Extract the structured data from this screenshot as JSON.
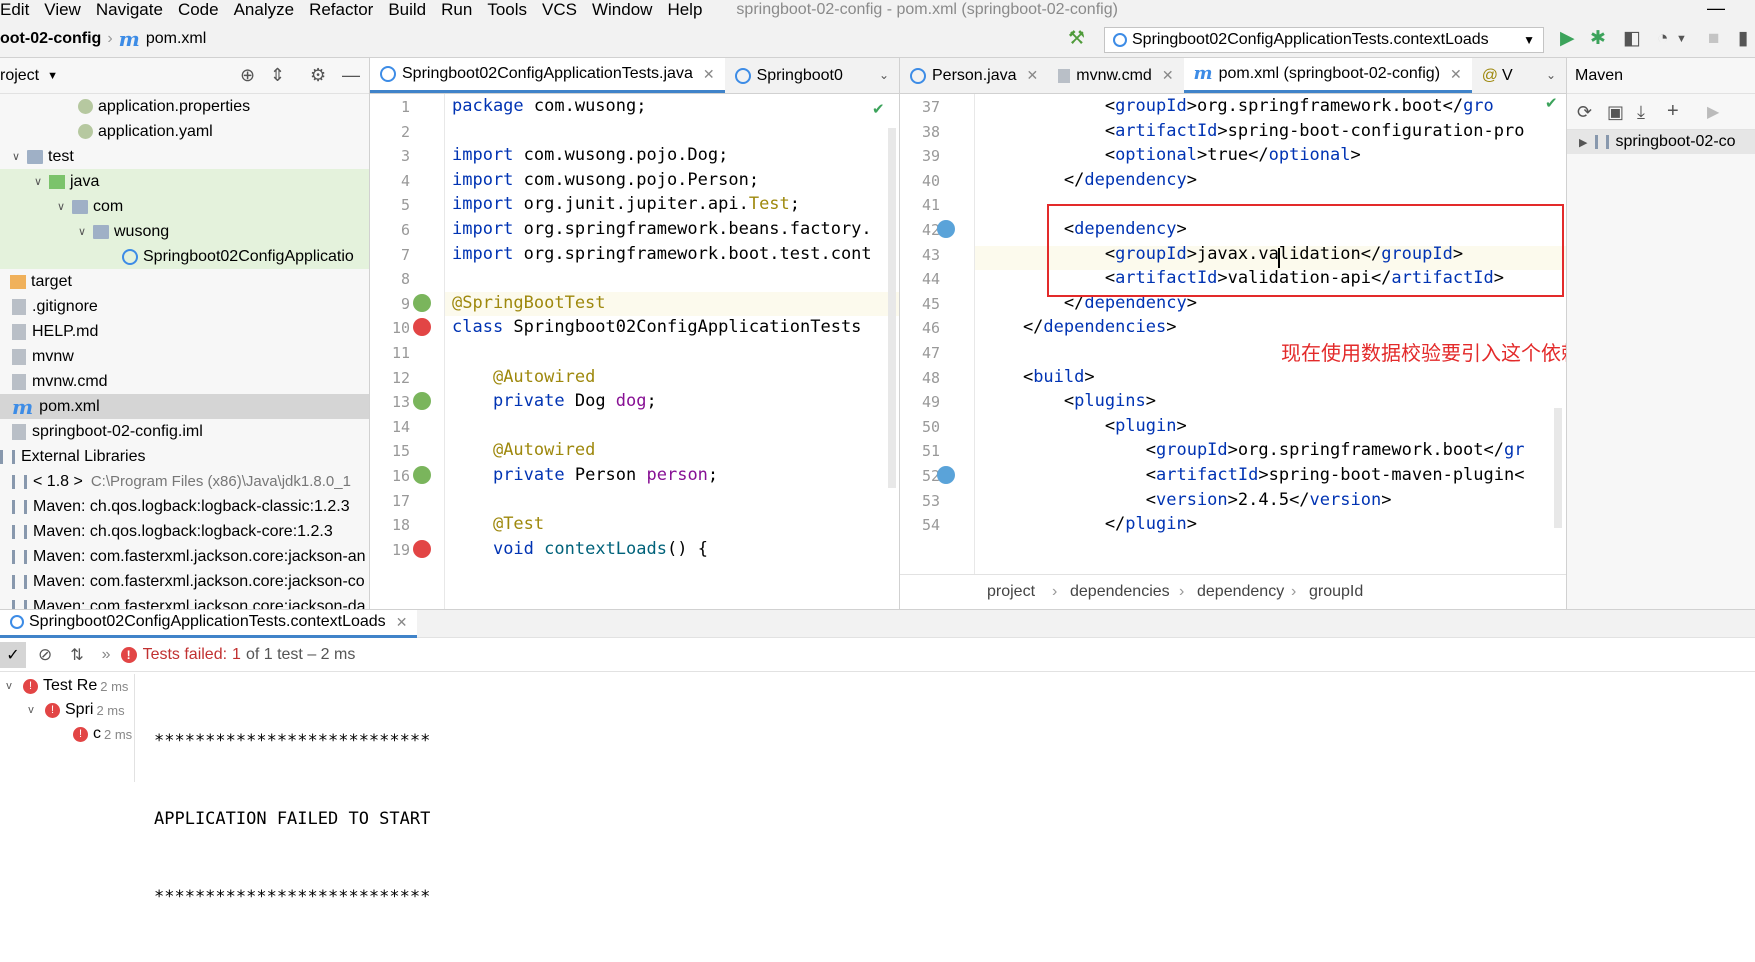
{
  "menu": [
    "Edit",
    "View",
    "Navigate",
    "Code",
    "Analyze",
    "Refactor",
    "Build",
    "Run",
    "Tools",
    "VCS",
    "Window",
    "Help"
  ],
  "window_title": "springboot-02-config - pom.xml (springboot-02-config)",
  "nav": {
    "project": "oot-02-config",
    "file": "pom.xml"
  },
  "run_config": "Springboot02ConfigApplicationTests.contextLoads",
  "project_panel": {
    "title": "roject",
    "tree": [
      {
        "label": "application.properties",
        "indent": 78,
        "icon": "properties-icon",
        "arrow": ""
      },
      {
        "label": "application.yaml",
        "indent": 78,
        "icon": "yaml-icon",
        "arrow": ""
      },
      {
        "label": "test",
        "indent": 10,
        "icon": "folder",
        "arrow": "v"
      },
      {
        "label": "java",
        "indent": 32,
        "icon": "gfolder",
        "arrow": "v"
      },
      {
        "label": "com",
        "indent": 55,
        "icon": "folder",
        "arrow": "v"
      },
      {
        "label": "wusong",
        "indent": 76,
        "icon": "folder",
        "arrow": "v"
      },
      {
        "label": "Springboot02ConfigApplicatio",
        "indent": 122,
        "icon": "class",
        "arrow": ""
      },
      {
        "label": "target",
        "indent": 10,
        "icon": "ofolder",
        "arrow": ""
      },
      {
        "label": ".gitignore",
        "indent": 12,
        "icon": "file",
        "arrow": ""
      },
      {
        "label": "HELP.md",
        "indent": 12,
        "icon": "md",
        "arrow": ""
      },
      {
        "label": "mvnw",
        "indent": 12,
        "icon": "file",
        "arrow": ""
      },
      {
        "label": "mvnw.cmd",
        "indent": 12,
        "icon": "file",
        "arrow": ""
      },
      {
        "label": "pom.xml",
        "indent": 12,
        "icon": "m",
        "arrow": ""
      },
      {
        "label": "springboot-02-config.iml",
        "indent": 12,
        "icon": "file",
        "arrow": ""
      },
      {
        "label": "External Libraries",
        "indent": 0,
        "icon": "lib",
        "arrow": ""
      },
      {
        "label": "< 1.8 >",
        "indent": 12,
        "icon": "lib",
        "arrow": "",
        "extra": "C:\\Program Files (x86)\\Java\\jdk1.8.0_1"
      },
      {
        "label": "Maven: ch.qos.logback:logback-classic:1.2.3",
        "indent": 12,
        "icon": "lib",
        "arrow": ""
      },
      {
        "label": "Maven: ch.qos.logback:logback-core:1.2.3",
        "indent": 12,
        "icon": "lib",
        "arrow": ""
      },
      {
        "label": "Maven: com.fasterxml.jackson.core:jackson-an",
        "indent": 12,
        "icon": "lib",
        "arrow": ""
      },
      {
        "label": "Maven: com.fasterxml.jackson.core:jackson-co",
        "indent": 12,
        "icon": "lib",
        "arrow": ""
      },
      {
        "label": "Maven: com.fasterxml.jackson.core:jackson-da",
        "indent": 12,
        "icon": "lib",
        "arrow": ""
      }
    ]
  },
  "left_editor": {
    "tabs": [
      "Springboot02ConfigApplicationTests.java",
      "Springboot0"
    ],
    "lines": [
      {
        "n": "1",
        "html": "<span class='kw'>package</span> com.wusong;"
      },
      {
        "n": "2",
        "html": ""
      },
      {
        "n": "3",
        "html": "<span class='kw'>import</span> com.wusong.pojo.Dog;"
      },
      {
        "n": "4",
        "html": "<span class='kw'>import</span> com.wusong.pojo.Person;"
      },
      {
        "n": "5",
        "html": "<span class='kw'>import</span> org.junit.jupiter.api.<span class='ann'>Test</span>;"
      },
      {
        "n": "6",
        "html": "<span class='kw'>import</span> org.springframework.beans.factory."
      },
      {
        "n": "7",
        "html": "<span class='kw'>import</span> org.springframework.boot.test.cont"
      },
      {
        "n": "8",
        "html": ""
      },
      {
        "n": "9",
        "html": "<span class='ann'>@SpringBootTest</span>"
      },
      {
        "n": "10",
        "html": "<span class='kw'>class</span> Springboot02ConfigApplicationTests"
      },
      {
        "n": "11",
        "html": ""
      },
      {
        "n": "12",
        "html": "    <span class='ann'>@Autowired</span>"
      },
      {
        "n": "13",
        "html": "    <span class='kw'>private</span> Dog <span class='fld'>dog</span>;"
      },
      {
        "n": "14",
        "html": ""
      },
      {
        "n": "15",
        "html": "    <span class='ann'>@Autowired</span>"
      },
      {
        "n": "16",
        "html": "    <span class='kw'>private</span> Person <span class='fld'>person</span>;"
      },
      {
        "n": "17",
        "html": ""
      },
      {
        "n": "18",
        "html": "    <span class='ann'>@Test</span>"
      },
      {
        "n": "19",
        "html": "    <span class='kw'>void</span> <span class='fn'>contextLoads</span>() {"
      }
    ]
  },
  "right_editor": {
    "tabs": [
      "Person.java",
      "mvnw.cmd",
      "pom.xml (springboot-02-config)",
      "V"
    ],
    "lines": [
      {
        "n": "37",
        "html": "            &lt;<span class='tag'>groupId</span>&gt;org.springframework.boot&lt;/<span class='tag'>gro</span>"
      },
      {
        "n": "38",
        "html": "            &lt;<span class='tag'>artifactId</span>&gt;spring-boot-configuration-pro"
      },
      {
        "n": "39",
        "html": "            &lt;<span class='tag'>optional</span>&gt;true&lt;/<span class='tag'>optional</span>&gt;"
      },
      {
        "n": "40",
        "html": "        &lt;/<span class='tag'>dependency</span>&gt;"
      },
      {
        "n": "41",
        "html": ""
      },
      {
        "n": "42",
        "html": "        &lt;<span class='tag'>dependency</span>&gt;"
      },
      {
        "n": "43",
        "html": "            &lt;<span class='tag'>groupId</span>&gt;javax.validation&lt;/<span class='tag'>groupId</span>&gt;"
      },
      {
        "n": "44",
        "html": "            &lt;<span class='tag'>artifactId</span>&gt;validation-api&lt;/<span class='tag'>artifactId</span>&gt;"
      },
      {
        "n": "45",
        "html": "        &lt;/<span class='tag'>dependency</span>&gt;"
      },
      {
        "n": "46",
        "html": "    &lt;/<span class='tag'>dependencies</span>&gt;"
      },
      {
        "n": "47",
        "html": ""
      },
      {
        "n": "48",
        "html": "    &lt;<span class='tag'>build</span>&gt;"
      },
      {
        "n": "49",
        "html": "        &lt;<span class='tag'>plugins</span>&gt;"
      },
      {
        "n": "50",
        "html": "            &lt;<span class='tag'>plugin</span>&gt;"
      },
      {
        "n": "51",
        "html": "                &lt;<span class='tag'>groupId</span>&gt;org.springframework.boot&lt;/<span class='tag'>gr</span>"
      },
      {
        "n": "52",
        "html": "                &lt;<span class='tag'>artifactId</span>&gt;spring-boot-maven-plugin&lt;"
      },
      {
        "n": "53",
        "html": "                &lt;<span class='tag'>version</span>&gt;2.4.5&lt;/<span class='tag'>version</span>&gt;"
      },
      {
        "n": "54",
        "html": "            &lt;/<span class='tag'>plugin</span>&gt;"
      }
    ],
    "annotation": "现在使用数据校验要引入这个依赖",
    "breadcrumbs": [
      "project",
      "dependencies",
      "dependency",
      "groupId"
    ]
  },
  "maven": {
    "title": "Maven",
    "root": "springboot-02-co"
  },
  "run_panel": {
    "tab": "Springboot02ConfigApplicationTests.contextLoads",
    "status_label": "Tests failed:",
    "status_count": "1",
    "status_rest": "of 1 test – 2 ms",
    "tree": [
      {
        "label": "Test Re",
        "time": "2 ms"
      },
      {
        "label": "Spri",
        "time": "2 ms"
      },
      {
        "label": "c",
        "time": "2 ms"
      }
    ],
    "console": [
      "***************************",
      "APPLICATION FAILED TO START",
      "***************************"
    ]
  },
  "colors": {
    "accent": "#4083c9",
    "error": "#e24545",
    "annotation": "#e32a2a",
    "run_green": "#3ca35b"
  }
}
